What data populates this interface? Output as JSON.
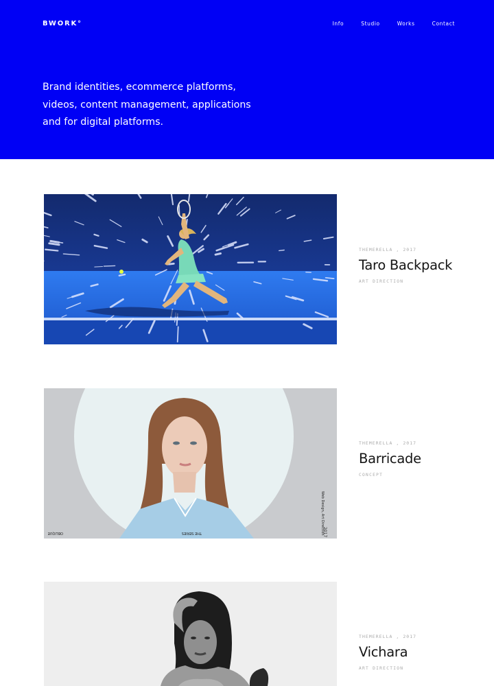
{
  "header": {
    "logo": "BWORK°",
    "nav": [
      "Info",
      "Studio",
      "Works",
      "Contact"
    ]
  },
  "hero": {
    "lines": [
      "Brand identities, ecommerce platforms,",
      "videos, content management, applications",
      "and for digital platforms."
    ],
    "background": "#0000f5"
  },
  "works": [
    {
      "client": "THEMERELLA , 2017",
      "title": "Taro Backpack",
      "category": "ART DIRECTION",
      "image": "tennis-player-photo"
    },
    {
      "client": "THEMERELLA , 2017",
      "title": "Barricade",
      "category": "CONCEPT",
      "image": "portrait-woman-circle-photo",
      "image_text": {
        "side": "Web Design, Art Direction",
        "year": "2017",
        "left": "OBLIQUE",
        "center": "THE SERIES"
      }
    },
    {
      "client": "THEMERELLA , 2017",
      "title": "Vichara",
      "category": "ART DIRECTION",
      "image": "bw-portrait-photo"
    }
  ]
}
